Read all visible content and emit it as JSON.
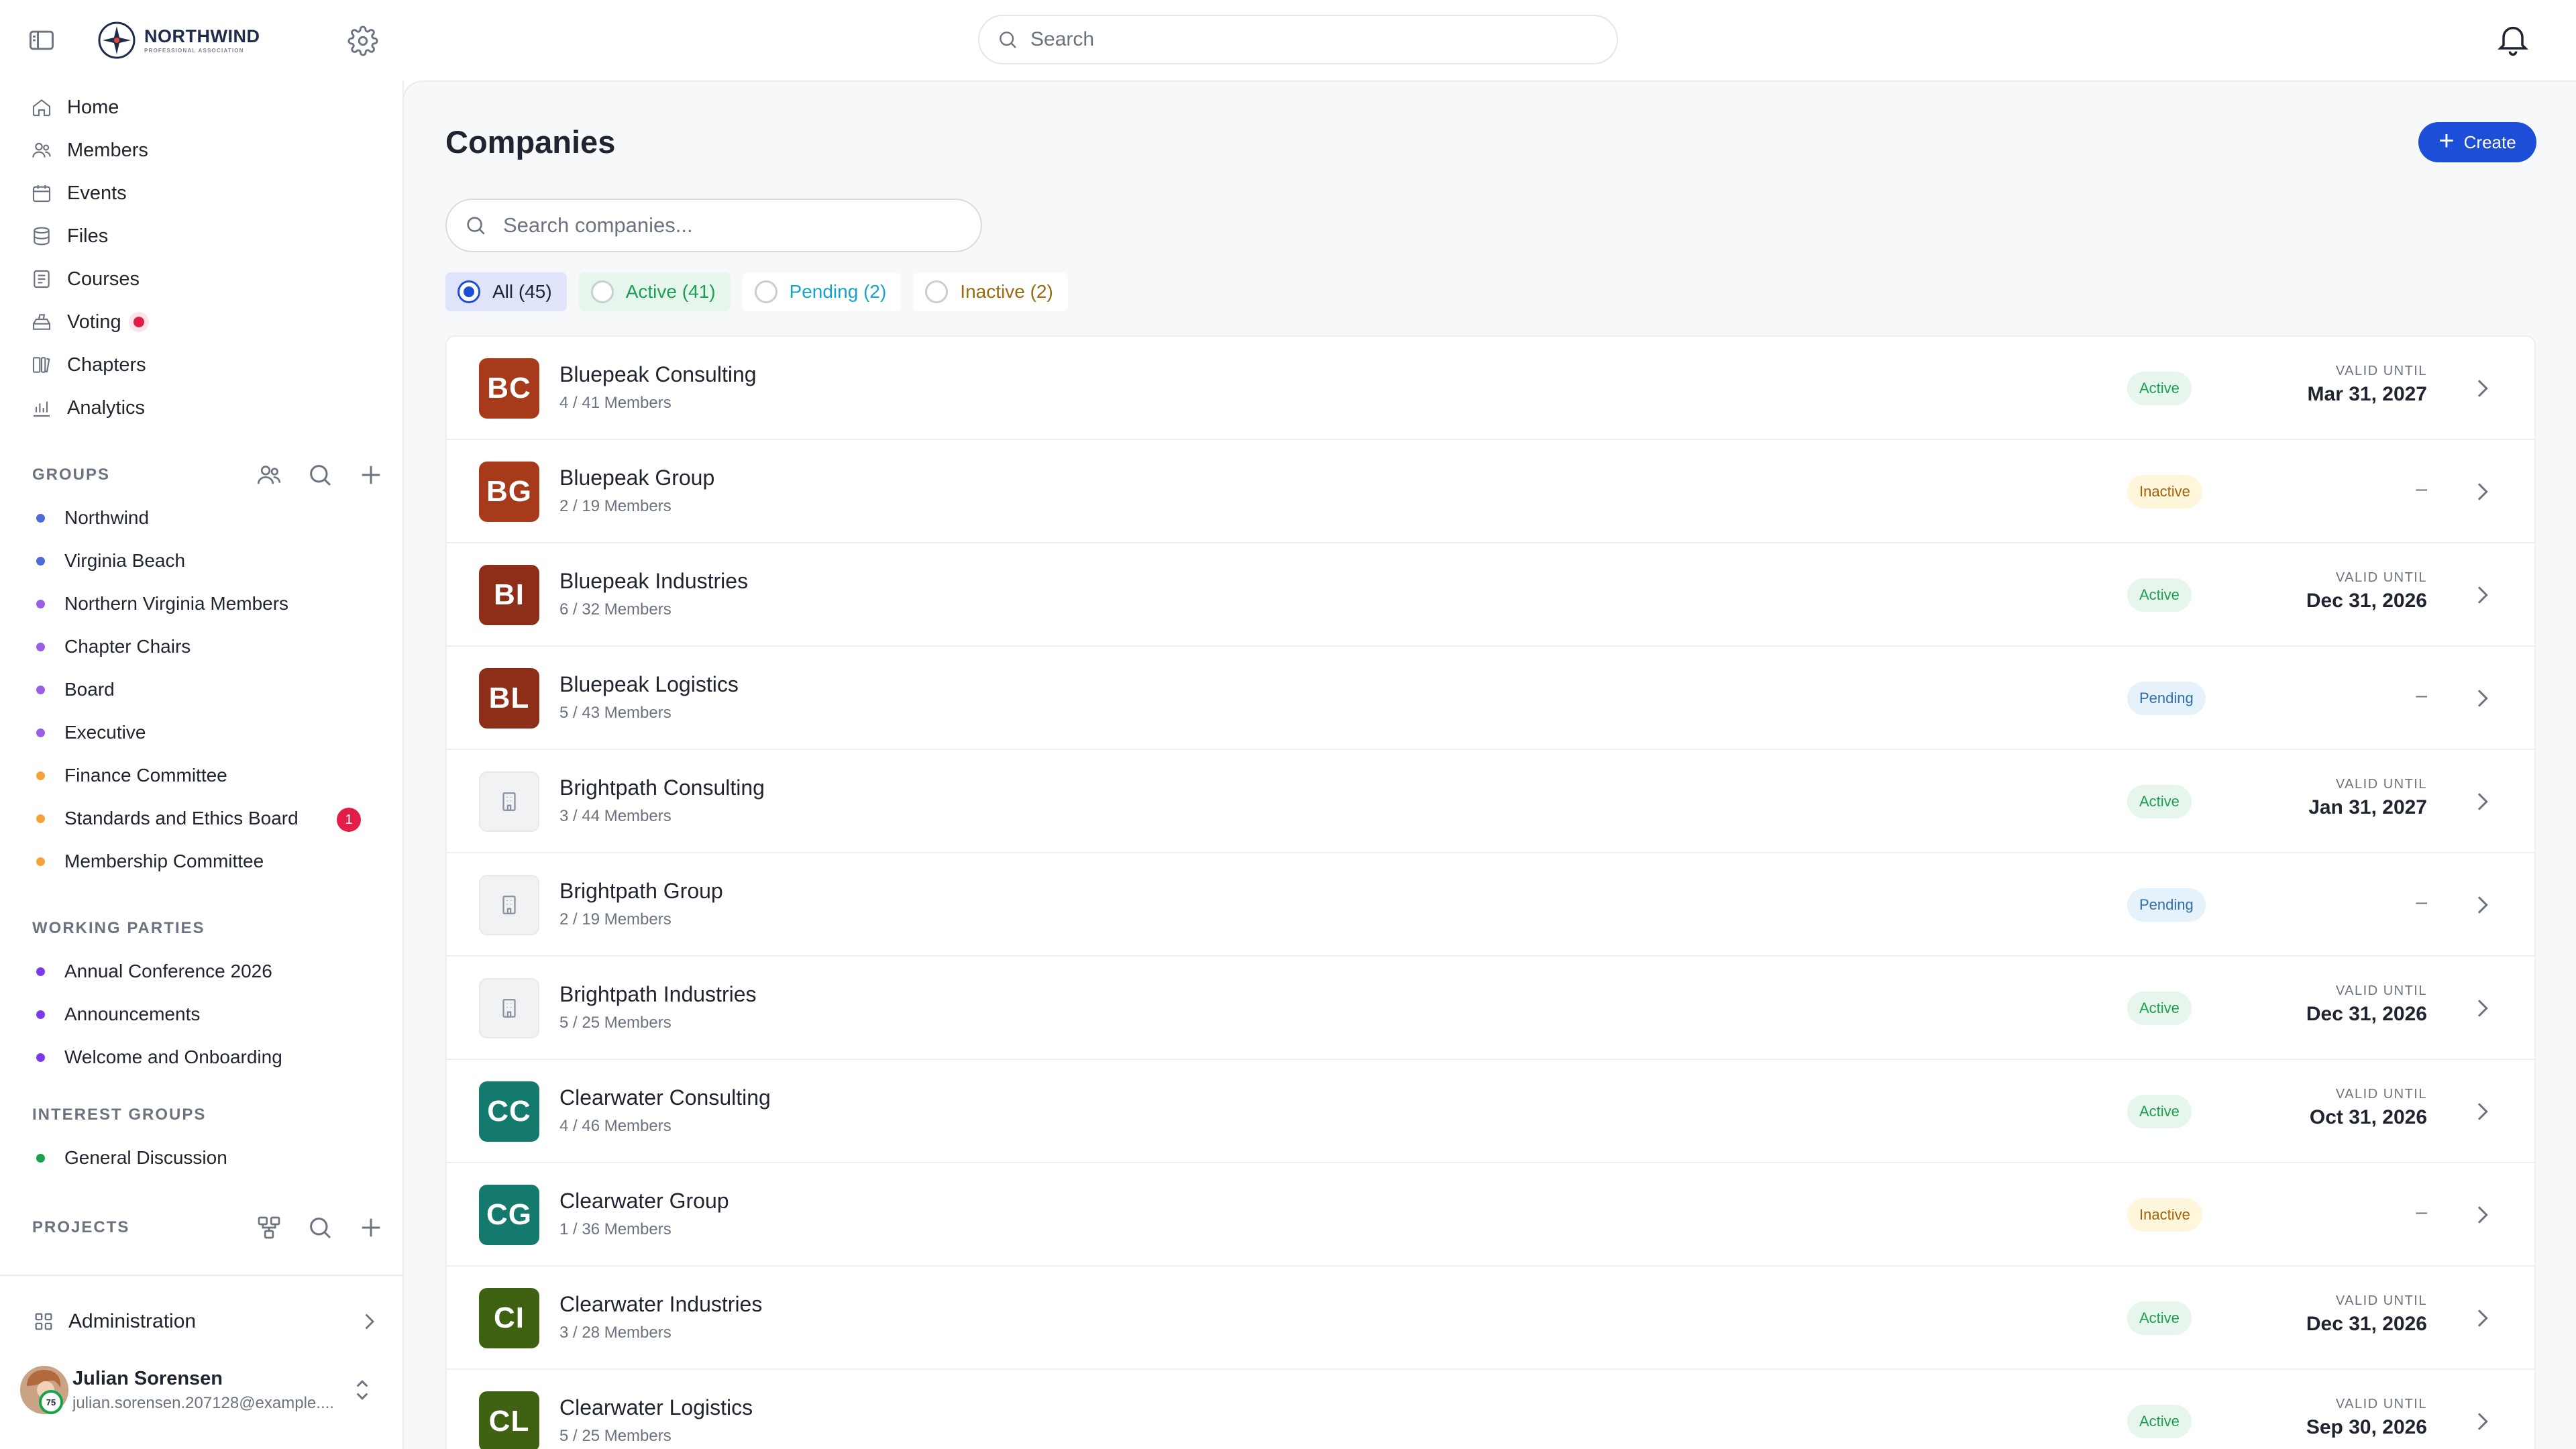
{
  "app": {
    "logo_title": "NORTHWIND",
    "logo_subtitle": "PROFESSIONAL ASSOCIATION"
  },
  "colors": {
    "primary": "#1d4ed8",
    "danger": "#e11d48",
    "active_green": "#1e9e54",
    "inactive_amber": "#a16207",
    "pending_blue": "#2f6ea5"
  },
  "topbar": {
    "search_placeholder": "Search"
  },
  "nav": [
    {
      "label": "Home",
      "icon": "home-icon"
    },
    {
      "label": "Members",
      "icon": "members-icon"
    },
    {
      "label": "Events",
      "icon": "calendar-icon"
    },
    {
      "label": "Files",
      "icon": "database-icon"
    },
    {
      "label": "Courses",
      "icon": "courses-icon"
    },
    {
      "label": "Voting",
      "icon": "ballot-icon",
      "has_notification": true
    },
    {
      "label": "Chapters",
      "icon": "chapters-icon"
    },
    {
      "label": "Analytics",
      "icon": "analytics-icon"
    }
  ],
  "groups": {
    "title": "GROUPS",
    "items": [
      {
        "label": "Northwind",
        "color": "#4f6bd8"
      },
      {
        "label": "Virginia Beach",
        "color": "#4f6bd8"
      },
      {
        "label": "Northern Virginia Members",
        "color": "#9b5de5"
      },
      {
        "label": "Chapter Chairs",
        "color": "#9b5de5"
      },
      {
        "label": "Board",
        "color": "#9b5de5"
      },
      {
        "label": "Executive",
        "color": "#9b5de5"
      },
      {
        "label": "Finance Committee",
        "color": "#f0a23b"
      },
      {
        "label": "Standards and Ethics Board",
        "color": "#f0a23b",
        "badge": "1"
      },
      {
        "label": "Membership Committee",
        "color": "#f0a23b"
      }
    ]
  },
  "working_parties": {
    "title": "WORKING PARTIES",
    "items": [
      {
        "label": "Annual Conference 2026",
        "color": "#7c3aed"
      },
      {
        "label": "Announcements",
        "color": "#7c3aed"
      },
      {
        "label": "Welcome and Onboarding",
        "color": "#7c3aed"
      }
    ]
  },
  "interest_groups": {
    "title": "INTEREST GROUPS",
    "items": [
      {
        "label": "General Discussion",
        "color": "#16a34a"
      }
    ]
  },
  "projects": {
    "title": "PROJECTS"
  },
  "admin": {
    "label": "Administration"
  },
  "user": {
    "name": "Julian Sorensen",
    "email": "julian.sorensen.207128@example....",
    "badge": "75"
  },
  "page": {
    "title": "Companies",
    "create_label": "Create",
    "search_placeholder": "Search companies...",
    "filters": [
      {
        "label": "All (45)",
        "selected": true
      },
      {
        "label": "Active (41)",
        "selected": false
      },
      {
        "label": "Pending (2)",
        "selected": false
      },
      {
        "label": "Inactive (2)",
        "selected": false
      }
    ],
    "valid_until_label": "VALID UNTIL",
    "companies": [
      {
        "initials": "BC",
        "name": "Bluepeak Consulting",
        "members": "4 / 41 Members",
        "status": "Active",
        "valid_until": "Mar 31, 2027",
        "logo_color": "#a83a1c"
      },
      {
        "initials": "BG",
        "name": "Bluepeak Group",
        "members": "2 / 19 Members",
        "status": "Inactive",
        "valid_until": "–",
        "logo_color": "#a83a1c"
      },
      {
        "initials": "BI",
        "name": "Bluepeak Industries",
        "members": "6 / 32 Members",
        "status": "Active",
        "valid_until": "Dec 31, 2026",
        "logo_color": "#8c2e18"
      },
      {
        "initials": "BL",
        "name": "Bluepeak Logistics",
        "members": "5 / 43 Members",
        "status": "Pending",
        "valid_until": "–",
        "logo_color": "#8c2e18"
      },
      {
        "initials": "",
        "name": "Brightpath Consulting",
        "members": "3 / 44 Members",
        "status": "Active",
        "valid_until": "Jan 31, 2027",
        "logo_color": ""
      },
      {
        "initials": "",
        "name": "Brightpath Group",
        "members": "2 / 19 Members",
        "status": "Pending",
        "valid_until": "–",
        "logo_color": ""
      },
      {
        "initials": "",
        "name": "Brightpath Industries",
        "members": "5 / 25 Members",
        "status": "Active",
        "valid_until": "Dec 31, 2026",
        "logo_color": ""
      },
      {
        "initials": "CC",
        "name": "Clearwater Consulting",
        "members": "4 / 46 Members",
        "status": "Active",
        "valid_until": "Oct 31, 2026",
        "logo_color": "#157a6e"
      },
      {
        "initials": "CG",
        "name": "Clearwater Group",
        "members": "1 / 36 Members",
        "status": "Inactive",
        "valid_until": "–",
        "logo_color": "#157a6e"
      },
      {
        "initials": "CI",
        "name": "Clearwater Industries",
        "members": "3 / 28 Members",
        "status": "Active",
        "valid_until": "Dec 31, 2026",
        "logo_color": "#3f6212"
      },
      {
        "initials": "CL",
        "name": "Clearwater Logistics",
        "members": "5 / 25 Members",
        "status": "Active",
        "valid_until": "Sep 30, 2026",
        "logo_color": "#3f6212"
      }
    ]
  }
}
